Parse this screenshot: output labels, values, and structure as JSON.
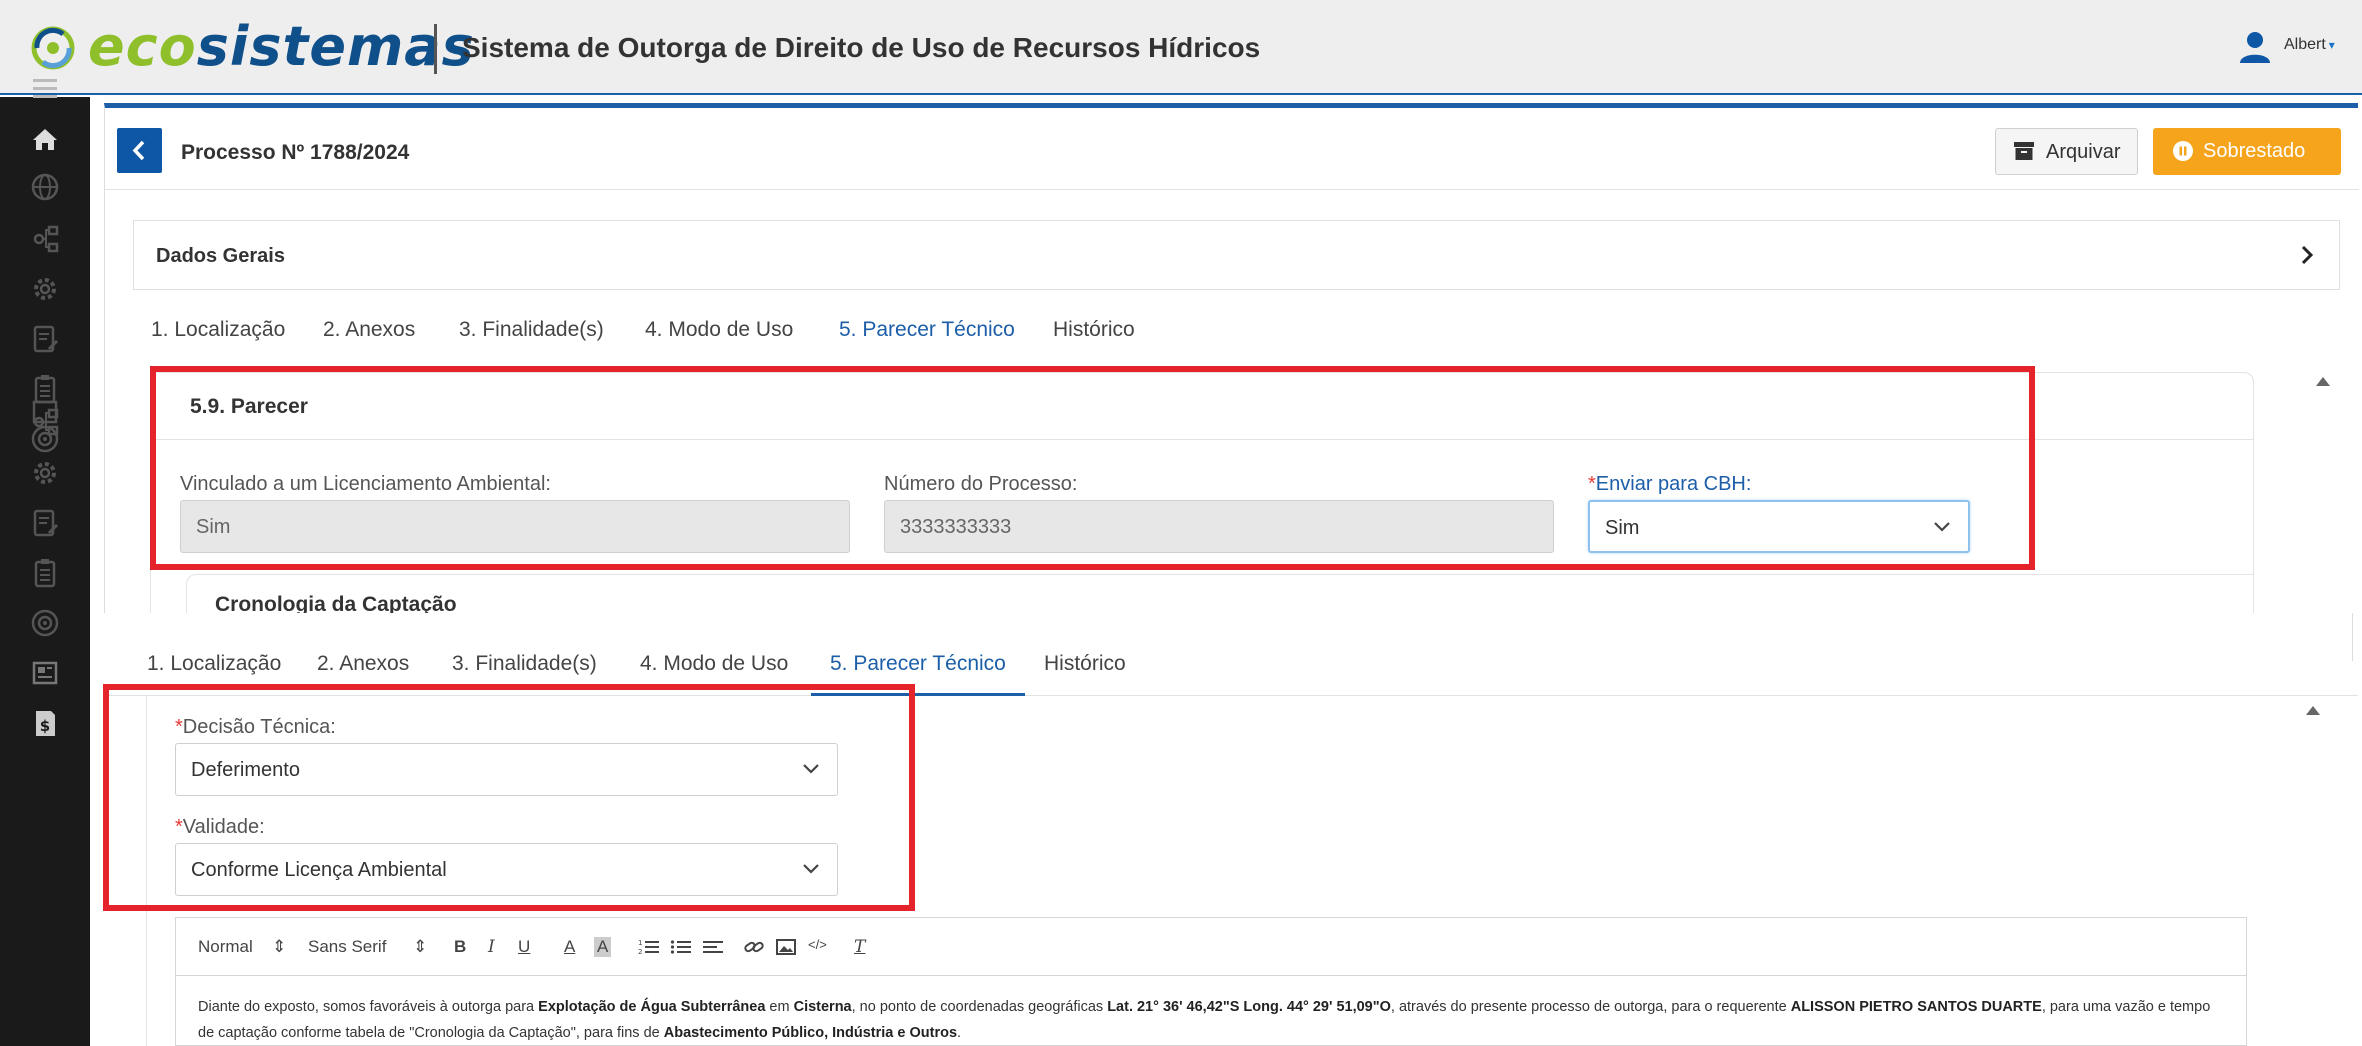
{
  "app": {
    "logo_eco": "eco",
    "logo_sistemas": "sistemas",
    "title": "Sistema de Outorga de Direito de Uso de Recursos Hídricos",
    "user_name": "Albert",
    "user_caret": "▾"
  },
  "sidebar": {
    "items": [
      {
        "icon": "menu-icon"
      },
      {
        "icon": "home-icon"
      },
      {
        "icon": "globe-icon"
      },
      {
        "icon": "network-icon"
      },
      {
        "icon": "settings-icon"
      },
      {
        "icon": "edit-document-icon"
      },
      {
        "icon": "clipboard-icon"
      },
      {
        "icon": "target-icon"
      },
      {
        "icon": "newspaper-icon"
      },
      {
        "icon": "network-icon"
      },
      {
        "icon": "settings-icon"
      },
      {
        "icon": "edit-document-icon"
      },
      {
        "icon": "clipboard-icon"
      },
      {
        "icon": "target-icon"
      },
      {
        "icon": "newspaper-icon"
      },
      {
        "icon": "billing-icon"
      }
    ]
  },
  "process": {
    "title": "Processo Nº 1788/2024",
    "archive_label": "Arquivar",
    "sobrestado_label": "Sobrestado"
  },
  "dados_gerais": {
    "label": "Dados Gerais"
  },
  "tabs": [
    {
      "label": "1. Localização"
    },
    {
      "label": "2. Anexos"
    },
    {
      "label": "3. Finalidade(s)"
    },
    {
      "label": "4. Modo de Uso"
    },
    {
      "label": "5. Parecer Técnico",
      "active": true
    },
    {
      "label": "Histórico"
    }
  ],
  "parecer": {
    "section_title": "5.9. Parecer",
    "vinculado_label": "Vinculado a um Licenciamento Ambiental:",
    "vinculado_value": "Sim",
    "numero_label": "Número do Processo:",
    "numero_value": "3333333333",
    "required_mark": "*",
    "enviar_label": "Enviar para CBH:",
    "enviar_value": "Sim",
    "cronologia_title": "Cronologia da Captação"
  },
  "decisao": {
    "required_mark": "*",
    "decisao_label": "Decisão Técnica:",
    "decisao_value": "Deferimento",
    "validade_label": "Validade:",
    "validade_value": "Conforme Licença Ambiental"
  },
  "editor": {
    "toolbar": {
      "format": "Normal",
      "font": "Sans Serif",
      "updown": "⇕",
      "bold": "B",
      "italic": "I",
      "underline": "U",
      "color": "A",
      "background": "A",
      "code": "</>",
      "clean": "T"
    },
    "text": {
      "p1": "Diante do exposto, somos favoráveis à outorga para ",
      "b1": "Explotação de Água Subterrânea",
      "p2": " em ",
      "b2": "Cisterna",
      "p3": ", no ponto de coordenadas geográficas ",
      "b3": "Lat. 21° 36' 46,42\"S Long. 44° 29' 51,09\"O",
      "p4": ", através do presente processo de outorga, para o requerente ",
      "b4": "ALISSON PIETRO SANTOS DUARTE",
      "p5": ", para uma vazão e tempo de captação conforme tabela de \"Cronologia da Captação\", para fins de ",
      "b5": "Abastecimento Público, Indústria e Outros",
      "p6": "."
    }
  },
  "colors": {
    "primary": "#1c5fa8",
    "accent_orange": "#f5a41c",
    "highlight_red": "#e5232b",
    "logo_green": "#8fc02c",
    "logo_blue": "#0f4f8a",
    "sidebar_bg": "#1a1a1a"
  }
}
